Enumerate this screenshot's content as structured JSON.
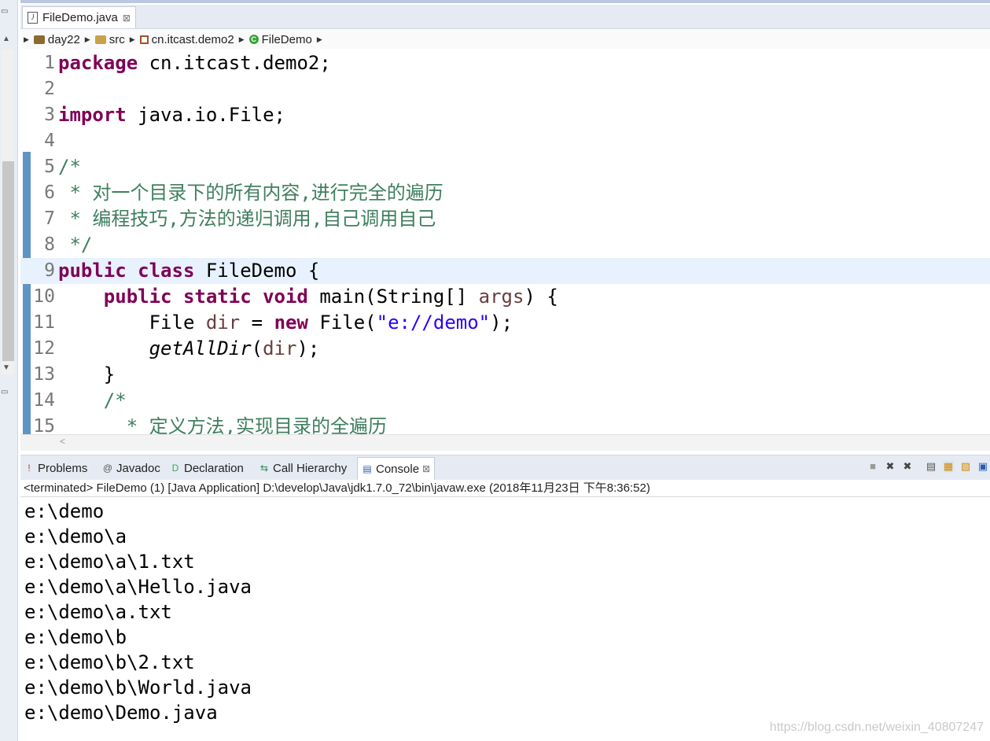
{
  "editor": {
    "tab_label": "FileDemo.java",
    "file_icon": "J",
    "tab_close": "⊠"
  },
  "breadcrumb": {
    "items": [
      "day22",
      "src",
      "cn.itcast.demo2",
      "FileDemo"
    ],
    "class_icon_letter": "C"
  },
  "code": {
    "line_numbers": [
      "1",
      "2",
      "3",
      "4",
      "5",
      "6",
      "7",
      "8",
      "9",
      "10",
      "11",
      "12",
      "13",
      "14",
      "15"
    ],
    "l1_kw": "package",
    "l1_rest": " cn.itcast.demo2;",
    "l3_kw": "import",
    "l3_rest": " java.io.File;",
    "l5": "/*",
    "l6": " * 对一个目录下的所有内容,进行完全的遍历",
    "l7": " * 编程技巧,方法的递归调用,自己调用自己",
    "l8": " */",
    "l9_kw": "public class",
    "l9_rest": " FileDemo {",
    "l10_kw": "public static void",
    "l10_mid": " main(String[] ",
    "l10_var": "args",
    "l10_end": ") {",
    "l11_pre": "File ",
    "l11_var": "dir",
    "l11_eq": " = ",
    "l11_kw": "new",
    "l11_call": " File(",
    "l11_str": "\"e://demo\"",
    "l11_end": ");",
    "l12_method": "getAllDir",
    "l12_open": "(",
    "l12_var": "dir",
    "l12_end": ");",
    "l13": "}",
    "l14": "/*",
    "l15": " * 定义方法,实现目录的全遍历"
  },
  "views": {
    "tabs": [
      "Problems",
      "Javadoc",
      "Declaration",
      "Call Hierarchy",
      "Console"
    ],
    "icons": [
      "!",
      "@",
      "D",
      "⇆",
      "▤"
    ],
    "console_close": "⊠",
    "toolbar_icons": [
      "stop-icon",
      "remove-launch-icon",
      "remove-all-icon",
      "clear-console-icon",
      "scroll-lock-icon",
      "word-wrap-icon",
      "display-selected-icon"
    ]
  },
  "console": {
    "status": "<terminated> FileDemo (1) [Java Application] D:\\develop\\Java\\jdk1.7.0_72\\bin\\javaw.exe (2018年11月23日 下午8:36:52)",
    "lines": [
      "e:\\demo",
      "e:\\demo\\a",
      "e:\\demo\\a\\1.txt",
      "e:\\demo\\a\\Hello.java",
      "e:\\demo\\a.txt",
      "e:\\demo\\b",
      "e:\\demo\\b\\2.txt",
      "e:\\demo\\b\\World.java",
      "e:\\demo\\Demo.java"
    ]
  },
  "watermark": "https://blog.csdn.net/weixin_40807247"
}
